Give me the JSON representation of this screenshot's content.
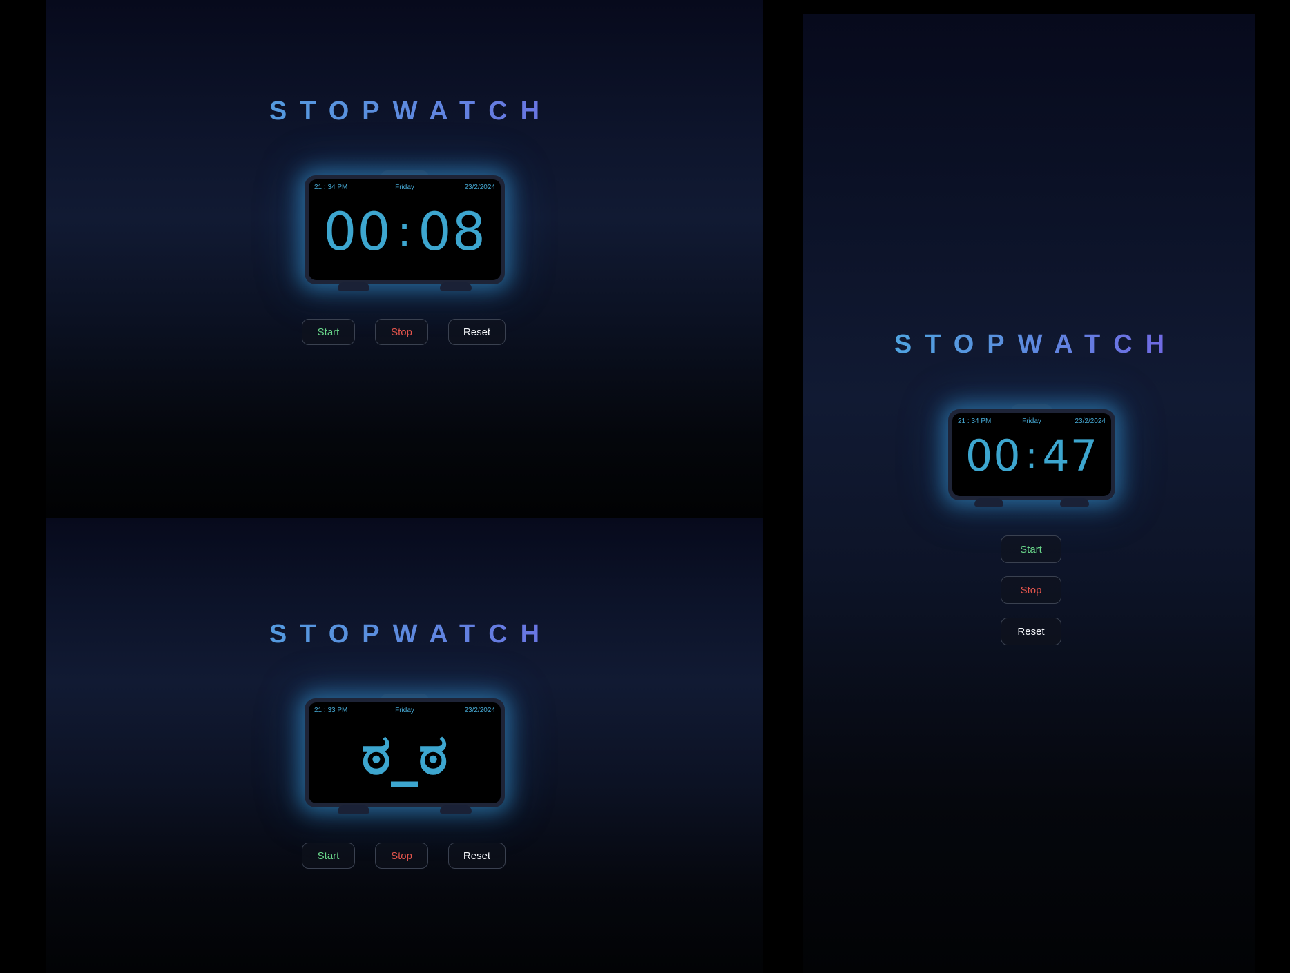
{
  "colors": {
    "accent": "#3da6cf",
    "title_gradient": [
      "#48b4e2",
      "#7d55e6"
    ],
    "start": "#69d68a",
    "stop": "#e4554c",
    "reset": "#f2f4f8",
    "background": "#000000"
  },
  "views": [
    {
      "title": "STOPWATCH",
      "clock": {
        "time": "21 : 34 PM",
        "day": "Friday",
        "date": "23/2/2024",
        "minutes": "00",
        "separator": ":",
        "seconds": "08"
      },
      "buttons": {
        "start": "Start",
        "stop": "Stop",
        "reset": "Reset"
      }
    },
    {
      "title": "STOPWATCH",
      "clock": {
        "time": "21 : 33 PM",
        "day": "Friday",
        "date": "23/2/2024",
        "face": "ಠ_ಠ"
      },
      "buttons": {
        "start": "Start",
        "stop": "Stop",
        "reset": "Reset"
      }
    },
    {
      "title": "STOPWATCH",
      "clock": {
        "time": "21 : 34 PM",
        "day": "Friday",
        "date": "23/2/2024",
        "minutes": "00",
        "separator": ":",
        "seconds": "47"
      },
      "buttons": {
        "start": "Start",
        "stop": "Stop",
        "reset": "Reset"
      }
    }
  ]
}
